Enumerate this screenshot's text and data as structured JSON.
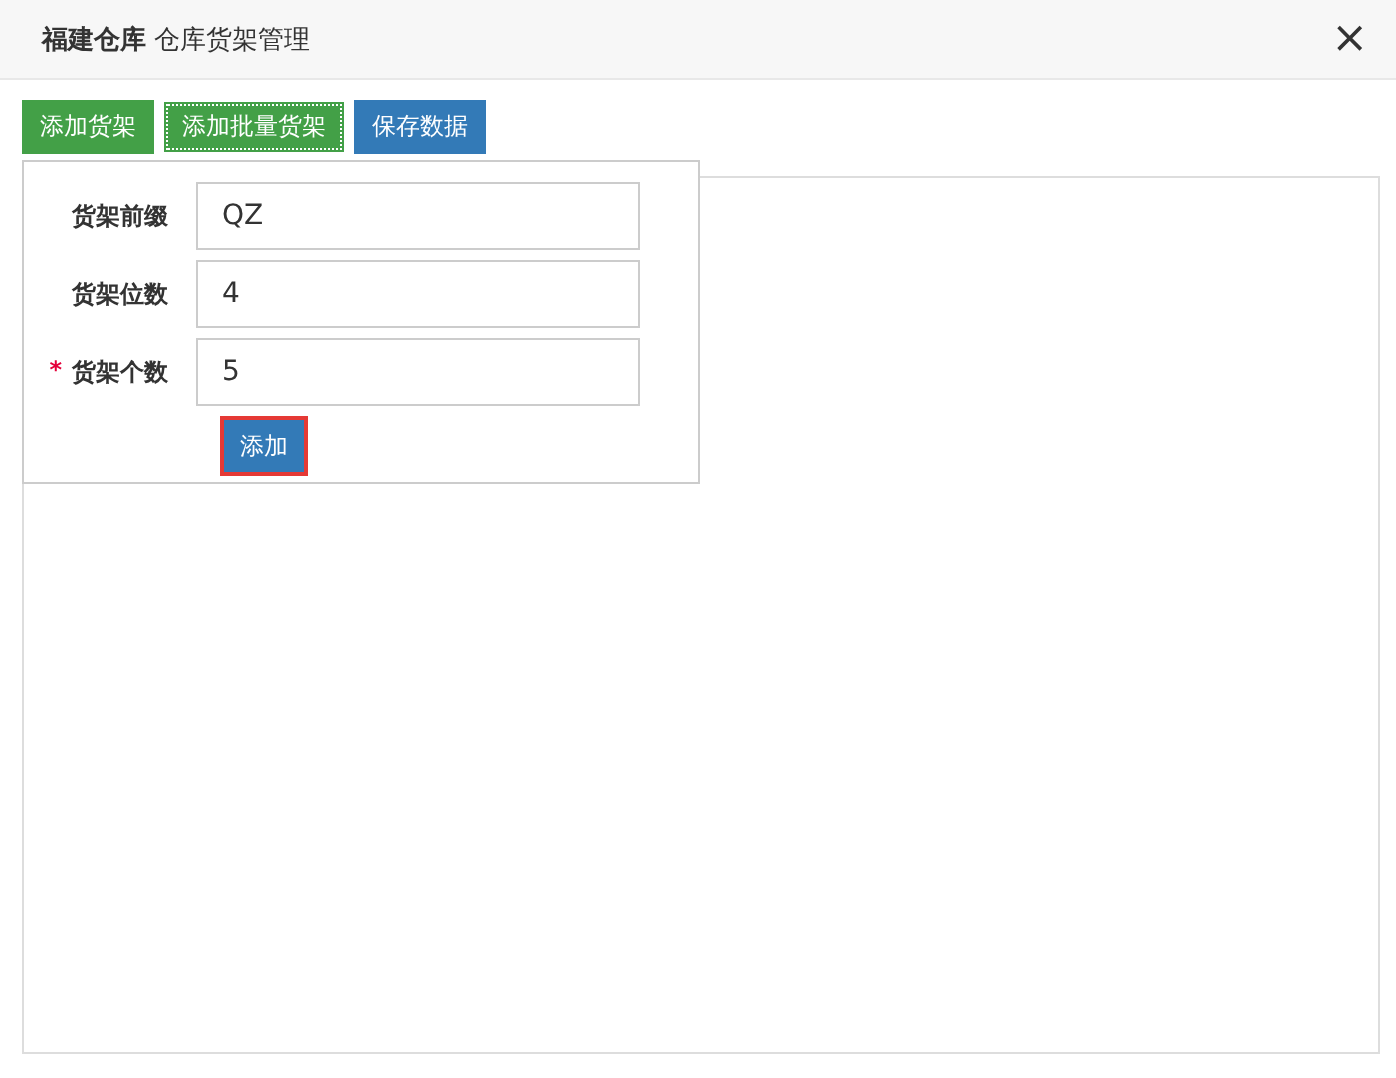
{
  "window": {
    "title_bold": "福建仓库",
    "title": "仓库货架管理",
    "close": "×"
  },
  "toolbar": [
    {
      "label": "添加货架",
      "kind": "success",
      "focused": false
    },
    {
      "label": "添加批量货架",
      "kind": "success",
      "focused": true
    },
    {
      "label": "保存数据",
      "kind": "primary",
      "focused": false
    }
  ],
  "popup": {
    "fields": [
      {
        "label": "货架前缀",
        "value": "QZ",
        "required": false
      },
      {
        "label": "货架位数",
        "value": "4",
        "required": false
      },
      {
        "label": "货架个数",
        "value": "5",
        "required": true
      }
    ],
    "required_mark": "*",
    "submit": {
      "label": "添加",
      "highlighted": true
    }
  }
}
